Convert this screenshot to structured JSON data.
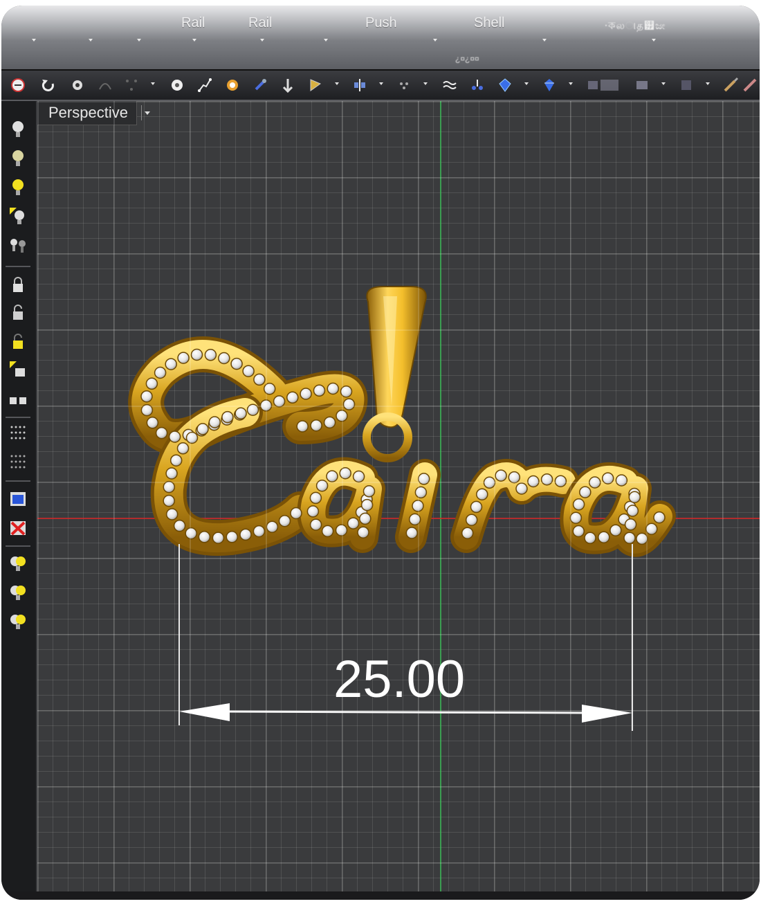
{
  "ribbon": {
    "groups": [
      "Rail",
      "Rail",
      "Push",
      "Shell"
    ],
    "blurred_label": "⸱কலାத୿ಜೕ",
    "sub_label": "¿¤¿¤¤"
  },
  "viewport": {
    "title": "Perspective"
  },
  "dimension": {
    "value": "25.00"
  },
  "model": {
    "text": "Caira"
  },
  "colors": {
    "gold": "#d9a520",
    "grid_background": "#3a3b3d",
    "x_axis": "#dc2828",
    "y_axis": "#3cc85a"
  }
}
